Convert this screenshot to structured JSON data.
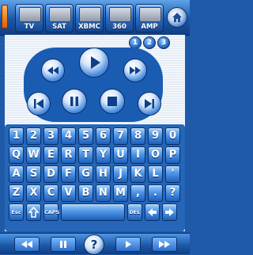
{
  "sources": [
    {
      "label": "TV",
      "icon": "tv-icon"
    },
    {
      "label": "SAT",
      "icon": "satellite-icon"
    },
    {
      "label": "XBMC",
      "icon": "xbmc-icon"
    },
    {
      "label": "360",
      "icon": "xbox-360-icon"
    },
    {
      "label": "AMP",
      "icon": "amplifier-icon"
    }
  ],
  "pages": [
    "1",
    "2",
    "3"
  ],
  "keyboard": {
    "row1": [
      "1",
      "2",
      "3",
      "4",
      "5",
      "6",
      "7",
      "8",
      "9",
      "0"
    ],
    "row2": [
      "Q",
      "W",
      "E",
      "R",
      "T",
      "Y",
      "U",
      "I",
      "O",
      "P"
    ],
    "row3": [
      "A",
      "S",
      "D",
      "F",
      "G",
      "H",
      "J",
      "K",
      "L",
      "'"
    ],
    "row4": [
      "Z",
      "X",
      "C",
      "V",
      "B",
      "N",
      "M",
      ",",
      ".",
      "?"
    ],
    "esc": "Esc",
    "caps": "CAPS",
    "del": "DEL"
  },
  "colors": {
    "accent": "#1f5aa9",
    "power": "#ff8a1f"
  }
}
